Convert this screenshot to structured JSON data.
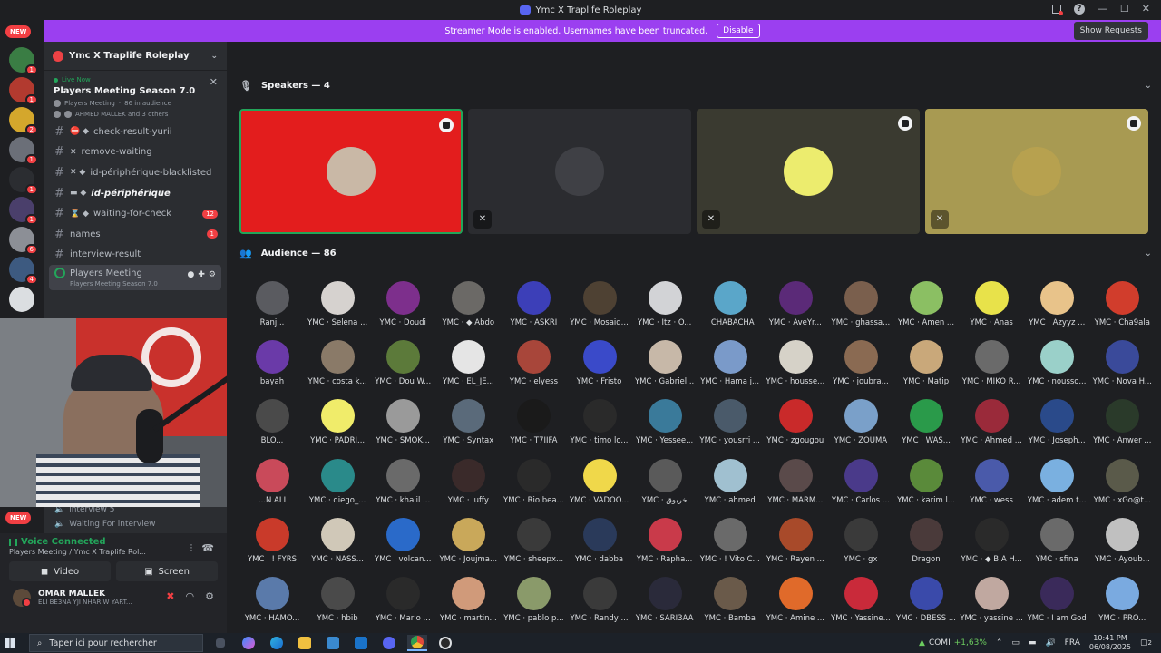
{
  "window": {
    "title": "Ymc X Traplife Roleplay"
  },
  "banner": {
    "text": "Streamer Mode is enabled. Usernames have been truncated.",
    "disable_label": "Disable",
    "show_requests_label": "Show Requests"
  },
  "rail": {
    "new_label": "NEW",
    "servers": [
      {
        "color": "#3a7d44",
        "count": "1"
      },
      {
        "color": "#b23a2f",
        "count": "1"
      },
      {
        "color": "#d4a72c",
        "count": "2"
      },
      {
        "color": "#6b6f78",
        "count": "1"
      },
      {
        "color": "#2b2d31",
        "count": "1"
      },
      {
        "color": "#4a3f6b",
        "count": "1"
      },
      {
        "color": "#8c8f96",
        "count": "6"
      },
      {
        "color": "#3d5a80",
        "count": "4"
      },
      {
        "color": "#dbdee1",
        "count": ""
      }
    ]
  },
  "sidebar": {
    "server_name": "Ymc X Traplife Roleplay",
    "live": {
      "live_label": "Live Now",
      "title": "Players Meeting Season 7.0",
      "channel": "Players Meeting",
      "audience": "86 in audience",
      "people": "AHMED MALLEK and 3 others"
    },
    "channels": [
      {
        "prefix": "⛔ ◆",
        "name": "check-result-yurii",
        "badge": ""
      },
      {
        "prefix": "✕",
        "name": "remove-waiting",
        "badge": ""
      },
      {
        "prefix": "✕ ◆",
        "name": "id-périphérique-blacklisted",
        "badge": ""
      },
      {
        "prefix": "▬ ◆",
        "name": "id-périphérique",
        "badge": ""
      },
      {
        "prefix": "⌛ ◆",
        "name": "waiting-for-check",
        "badge": "12"
      },
      {
        "prefix": "",
        "name": "names",
        "badge": "1"
      },
      {
        "prefix": "",
        "name": "interview-result",
        "badge": ""
      }
    ],
    "active_channel": {
      "name": "Players Meeting",
      "sub": "Players Meeting Season 7.0"
    },
    "below_cam": [
      "interview 5",
      "Waiting For interview"
    ],
    "new_label_2": "NEW"
  },
  "voice": {
    "status": "Voice Connected",
    "channel": "Players Meeting / Ymc X Traplife Rol...",
    "video_label": "Video",
    "screen_label": "Screen",
    "user_name": "OMAR MALLEK",
    "user_status": "ELI BE3NA YJI NHAR W YART..."
  },
  "speakers": {
    "heading": "Speakers — 4",
    "tiles": [
      {
        "bg": "#e31d1d",
        "avatar": "#c9b8a6",
        "speaking": true,
        "muted": false,
        "badge": true
      },
      {
        "bg": "#2b2c30",
        "avatar": "#3f4045",
        "speaking": false,
        "muted": true,
        "badge": false
      },
      {
        "bg": "#3a3a30",
        "avatar": "#ecec6e",
        "speaking": false,
        "muted": true,
        "badge": true
      },
      {
        "bg": "#a89a52",
        "avatar": "#b7a14f",
        "speaking": false,
        "muted": true,
        "badge": true
      }
    ]
  },
  "audience": {
    "heading": "Audience — 86",
    "members": [
      {
        "name": "Ranj...",
        "color": "#5a5b60"
      },
      {
        "name": "YMC · Selena ...",
        "color": "#d6d2cf"
      },
      {
        "name": "YMC · Doudi",
        "color": "#7d2f8c"
      },
      {
        "name": "YMC · ◆ Abdo",
        "color": "#6b6966"
      },
      {
        "name": "YMC · ASKRI",
        "color": "#3c3fb8"
      },
      {
        "name": "YMC · Mosaiq...",
        "color": "#4e4133"
      },
      {
        "name": "YMC · Itz · O...",
        "color": "#d2d3d6"
      },
      {
        "name": "! CHABACHA",
        "color": "#5aa6c9"
      },
      {
        "name": "YMC · AveYr...",
        "color": "#5b2a78"
      },
      {
        "name": "YMC · ghassa...",
        "color": "#7a5f4d"
      },
      {
        "name": "YMC · Amen ...",
        "color": "#8bbf63"
      },
      {
        "name": "YMC · Anas",
        "color": "#e8e24a"
      },
      {
        "name": "YMC · Azyyz ...",
        "color": "#e8c38a"
      },
      {
        "name": "YMC · Cha9ala",
        "color": "#d13d2c"
      },
      {
        "name": "bayah",
        "color": "#6a3aa8"
      },
      {
        "name": "YMC · costa k...",
        "color": "#8a7a68"
      },
      {
        "name": "YMC · Dou W...",
        "color": "#5c7a3a"
      },
      {
        "name": "YMC · EL_JE...",
        "color": "#e5e5e5"
      },
      {
        "name": "YMC · elyess",
        "color": "#a8463a"
      },
      {
        "name": "YMC · Fristo",
        "color": "#3a4ac9"
      },
      {
        "name": "YMC · Gabriel...",
        "color": "#c7b8a8"
      },
      {
        "name": "YMC · Hama j...",
        "color": "#7a9ac9"
      },
      {
        "name": "YMC · housse...",
        "color": "#d6d2c8"
      },
      {
        "name": "YMC · joubra...",
        "color": "#8a6a52"
      },
      {
        "name": "YMC · Matip",
        "color": "#c9a87a"
      },
      {
        "name": "YMC · MIKO R...",
        "color": "#6a6a6a"
      },
      {
        "name": "YMC · nousso...",
        "color": "#9ad0c9"
      },
      {
        "name": "YMC · Nova H...",
        "color": "#3a4a9a"
      },
      {
        "name": "BLO...",
        "color": "#4a4a4a"
      },
      {
        "name": "YMC · PADRI...",
        "color": "#f0ec6a"
      },
      {
        "name": "YMC · SMOK...",
        "color": "#9a9a9a"
      },
      {
        "name": "YMC · Syntax",
        "color": "#5a6a7a"
      },
      {
        "name": "YMC · T7IIFA",
        "color": "#1a1a1a"
      },
      {
        "name": "YMC · timo lo...",
        "color": "#2a2a2a"
      },
      {
        "name": "YMC · Yessee...",
        "color": "#3a7a9a"
      },
      {
        "name": "YMC · yousrri ...",
        "color": "#4a5a6a"
      },
      {
        "name": "YMC · zgougou",
        "color": "#c92a2a"
      },
      {
        "name": "YMC · ZOUMA",
        "color": "#7aa0c9"
      },
      {
        "name": "YMC · WAS...",
        "color": "#2a9a4a"
      },
      {
        "name": "YMC · Ahmed ...",
        "color": "#9a2a3a"
      },
      {
        "name": "YMC · Joseph...",
        "color": "#2a4a8a"
      },
      {
        "name": "YMC · Anwer ...",
        "color": "#2a3a2a"
      },
      {
        "name": "...N ALI",
        "color": "#c94a5a"
      },
      {
        "name": "YMC · diego_...",
        "color": "#2a8a8a"
      },
      {
        "name": "YMC · khalil ...",
        "color": "#6a6a6a"
      },
      {
        "name": "YMC · luffy",
        "color": "#3a2a2a"
      },
      {
        "name": "YMC · Rio bea...",
        "color": "#2a2a2a"
      },
      {
        "name": "YMC · VADOO...",
        "color": "#f0d84a"
      },
      {
        "name": "YMC · خربوق",
        "color": "#5a5a5a"
      },
      {
        "name": "YMC · ahmed",
        "color": "#a0c0d0"
      },
      {
        "name": "YMC · MARM...",
        "color": "#5a4a4a"
      },
      {
        "name": "YMC · Carlos ...",
        "color": "#4a3a8a"
      },
      {
        "name": "YMC · karim l...",
        "color": "#5a8a3a"
      },
      {
        "name": "YMC · wess",
        "color": "#4a5aaa"
      },
      {
        "name": "YMC · adem t...",
        "color": "#7ab0e0"
      },
      {
        "name": "YMC · xGo@t...",
        "color": "#5a5a4a"
      },
      {
        "name": "YMC · ! FYRS",
        "color": "#c93a2a"
      },
      {
        "name": "YMC · NASS...",
        "color": "#d0c8b8"
      },
      {
        "name": "YMC · volcan...",
        "color": "#2a6ac9"
      },
      {
        "name": "YMC · Joujma...",
        "color": "#c9a85a"
      },
      {
        "name": "YMC · sheepx...",
        "color": "#3a3a3a"
      },
      {
        "name": "YMC · dabba",
        "color": "#2a3a5a"
      },
      {
        "name": "YMC · Rapha...",
        "color": "#c93a4a"
      },
      {
        "name": "YMC · ! Vito C...",
        "color": "#6a6a6a"
      },
      {
        "name": "YMC · Rayen ...",
        "color": "#a84a2a"
      },
      {
        "name": "YMC · gx",
        "color": "#3a3a3a"
      },
      {
        "name": "Dragon",
        "color": "#4a3a3a"
      },
      {
        "name": "YMC · ◆ B A H...",
        "color": "#2a2a2a"
      },
      {
        "name": "YMC · sfina",
        "color": "#6a6a6a"
      },
      {
        "name": "YMC · Ayoub...",
        "color": "#c0c0c0"
      },
      {
        "name": "YMC · HAMO...",
        "color": "#5a7aaa"
      },
      {
        "name": "YMC · hbib",
        "color": "#4a4a4a"
      },
      {
        "name": "YMC · Mario ...",
        "color": "#2a2a2a"
      },
      {
        "name": "YMC · martin...",
        "color": "#d09a7a"
      },
      {
        "name": "YMC · pablo p...",
        "color": "#8a9a6a"
      },
      {
        "name": "YMC · Randy ...",
        "color": "#3a3a3a"
      },
      {
        "name": "YMC · SARI3AA",
        "color": "#2a2a3a"
      },
      {
        "name": "YMC · Bamba",
        "color": "#6a5a4a"
      },
      {
        "name": "YMC · Amine ...",
        "color": "#e06a2a"
      },
      {
        "name": "YMC · Yassine...",
        "color": "#c92a3a"
      },
      {
        "name": "YMC · DBESS ...",
        "color": "#3a4aaa"
      },
      {
        "name": "YMC · yassine ...",
        "color": "#c0a8a0"
      },
      {
        "name": "YMC · I am God",
        "color": "#3a2a5a"
      },
      {
        "name": "YMC · PRO...",
        "color": "#7aaae0"
      }
    ]
  },
  "taskbar": {
    "search_placeholder": "Taper ici pour rechercher",
    "stock_name": "COMI",
    "stock_change": "+1,63%",
    "language": "FRA",
    "time": "10:41 PM",
    "date": "06/08/2025",
    "notif_count": "2"
  }
}
